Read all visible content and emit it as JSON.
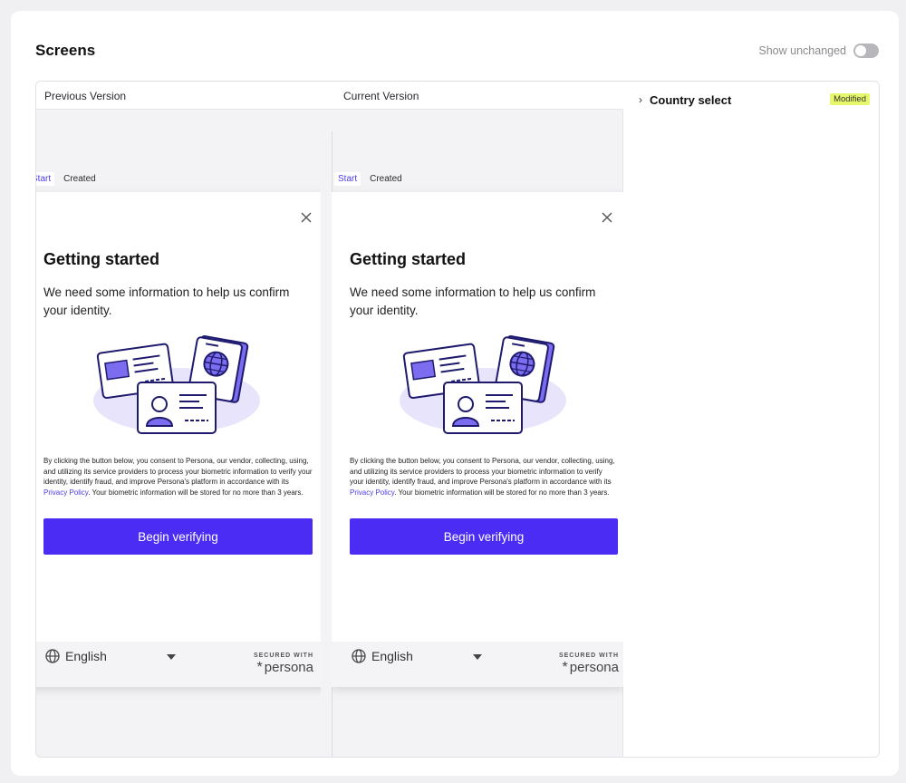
{
  "header": {
    "title": "Screens",
    "show_unchanged_label": "Show unchanged",
    "show_unchanged_on": false
  },
  "compare": {
    "previous_label": "Previous Version",
    "current_label": "Current Version"
  },
  "tags": {
    "start": "Start",
    "created": "Created"
  },
  "screen": {
    "title": "Getting started",
    "subtitle": "We need some information to help us confirm your identity.",
    "consent_before": "By clicking the button below, you consent to Persona, our vendor, collecting, using, and utilizing its service providers to process your biometric information to verify your identity, identify fraud, and improve Persona's platform in accordance with its ",
    "consent_link": "Privacy Policy",
    "consent_after": ". Your biometric information will be stored for no more than 3 years.",
    "button": "Begin verifying",
    "language": "English",
    "secured_with": "SECURED WITH",
    "brand": "persona"
  },
  "details": {
    "items": [
      {
        "label": "Country select",
        "status": "Modified"
      }
    ]
  },
  "colors": {
    "accent": "#4b2cf5",
    "badge": "#e7f76b",
    "illustration": "#1e1b6e",
    "illustration_fill": "#7c6cf0"
  },
  "icons": [
    "close-icon",
    "globe-icon",
    "chevron-right-icon",
    "caret-down-icon",
    "persona-logo-icon"
  ]
}
